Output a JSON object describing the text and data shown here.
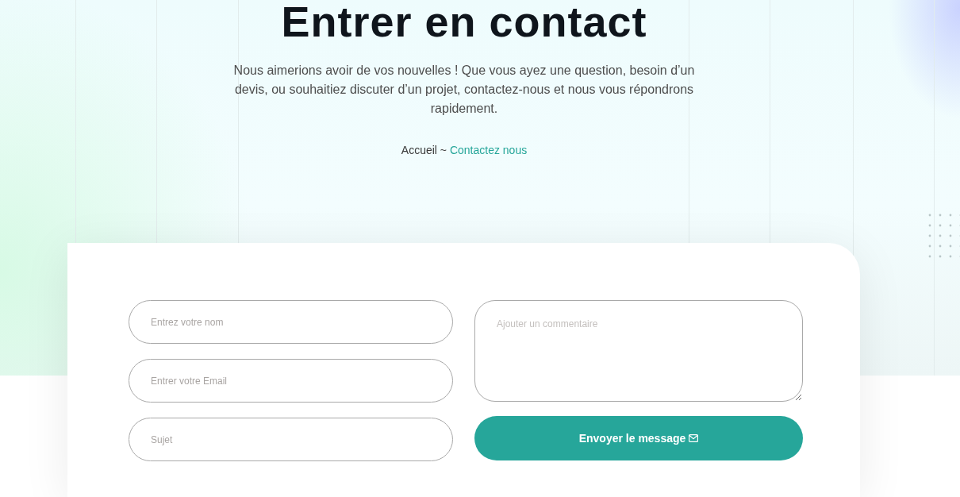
{
  "header": {
    "title": "Entrer en contact",
    "intro": "Nous aimerions avoir de vos nouvelles ! Que vous ayez une question, besoin d’un devis, ou souhaitiez discuter d’un projet, contactez-nous et nous vous répondrons rapidement."
  },
  "breadcrumb": {
    "separator": "~",
    "items": [
      {
        "label": "Accueil",
        "current": false
      },
      {
        "label": "Contactez nous",
        "current": true
      }
    ]
  },
  "form": {
    "fields": [
      {
        "kind": "input",
        "placeholder": "Entrez votre nom"
      },
      {
        "kind": "input",
        "placeholder": "Entrer votre Email"
      },
      {
        "kind": "input",
        "placeholder": "Sujet"
      },
      {
        "kind": "textarea",
        "placeholder": "Ajouter un commentaire"
      }
    ],
    "submit": {
      "label": "Envoyer le message"
    }
  }
}
